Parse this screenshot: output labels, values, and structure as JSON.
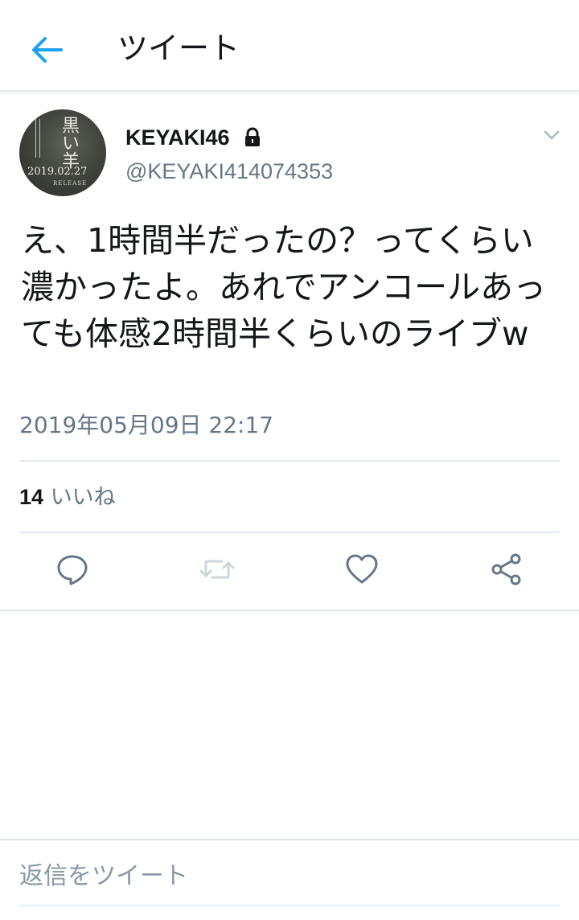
{
  "header": {
    "title": "ツイート",
    "back_icon": "arrow-left-icon",
    "accent": "#1da1f2"
  },
  "tweet": {
    "avatar": {
      "kanji": "黒い羊",
      "date_text": "2019.02.27",
      "release_text": "RELEASE"
    },
    "display_name": "KEYAKI46",
    "protected_icon": "lock-icon",
    "handle": "@KEYAKI414074353",
    "more_icon": "chevron-down-icon",
    "text": "え、1時間半だったの？ってくらい濃かったよ。あれでアンコールあっても体感2時間半くらいのライブw",
    "timestamp": "2019年05月09日 22:17",
    "likes_count": "14",
    "likes_label": "いいね"
  },
  "actions": {
    "reply_icon": "reply-icon",
    "retweet_icon": "retweet-icon",
    "like_icon": "heart-icon",
    "share_icon": "share-icon"
  },
  "reply_bar": {
    "placeholder": "返信をツイート"
  },
  "colors": {
    "text_primary": "#14171a",
    "text_secondary": "#657786",
    "divider": "#e1e8ed",
    "icon_gray": "#657786"
  }
}
